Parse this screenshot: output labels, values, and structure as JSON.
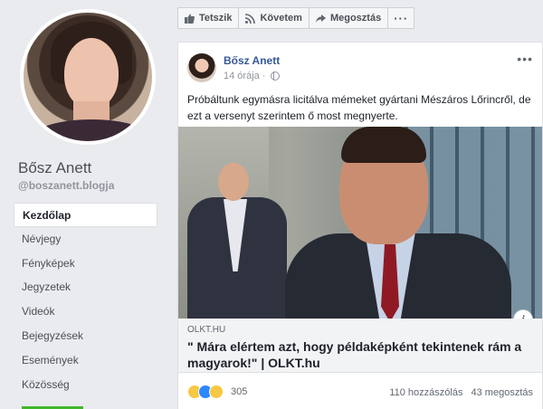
{
  "profile": {
    "name": "Bősz Anett",
    "handle": "@boszanett.blogja"
  },
  "nav": {
    "items": [
      {
        "label": "Kezdőlap",
        "active": true
      },
      {
        "label": "Névjegy"
      },
      {
        "label": "Fényképek"
      },
      {
        "label": "Jegyzetek"
      },
      {
        "label": "Videók"
      },
      {
        "label": "Bejegyzések"
      },
      {
        "label": "Események"
      },
      {
        "label": "Közösség"
      }
    ]
  },
  "actions": {
    "like": "Tetszik",
    "follow": "Követem",
    "share": "Megosztás",
    "more": "···"
  },
  "post": {
    "author": "Bősz Anett",
    "time": "14 órája ·",
    "text": "Próbáltunk egymásra licitálva mémeket gyártani Mészáros Lőrincről, de ezt a versenyt szerintem ő most megnyerte.",
    "menu": "•••",
    "link": {
      "domain": "OLKT.HU",
      "title": "\" Mára elértem azt, hogy példaképként tekintenek rám a magyarok!\" | OLKT.hu"
    },
    "info": "i",
    "reactions_count": "305",
    "comments": "110 hozzászólás",
    "shares": "43 megosztás"
  },
  "colors": {
    "link_blue": "#365899",
    "accent_green": "#42b72a"
  }
}
